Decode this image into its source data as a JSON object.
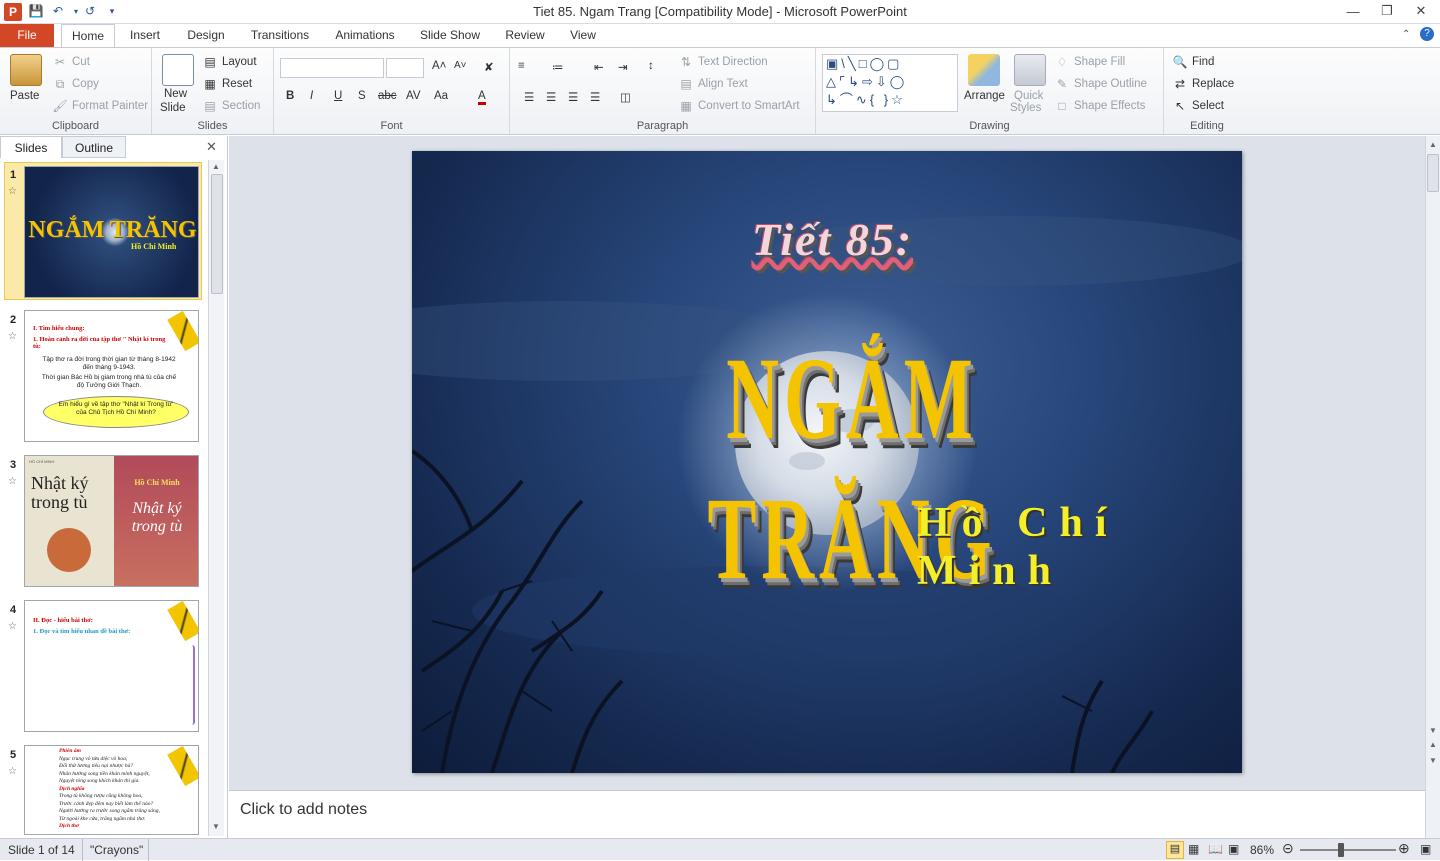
{
  "window": {
    "title": "Tiet 85. Ngam Trang [Compatibility Mode]  -  Microsoft PowerPoint"
  },
  "tabs": [
    "File",
    "Home",
    "Insert",
    "Design",
    "Transitions",
    "Animations",
    "Slide Show",
    "Review",
    "View"
  ],
  "ribbon": {
    "clipboard": {
      "label": "Clipboard",
      "paste": "Paste",
      "cut": "Cut",
      "copy": "Copy",
      "format_painter": "Format Painter"
    },
    "slides": {
      "label": "Slides",
      "new_slide_1": "New",
      "new_slide_2": "Slide",
      "layout": "Layout",
      "reset": "Reset",
      "section": "Section"
    },
    "font": {
      "label": "Font"
    },
    "paragraph": {
      "label": "Paragraph",
      "text_direction": "Text Direction",
      "align_text": "Align Text",
      "convert_smartart": "Convert to SmartArt"
    },
    "drawing": {
      "label": "Drawing",
      "arrange": "Arrange",
      "quick_styles_1": "Quick",
      "quick_styles_2": "Styles",
      "shape_fill": "Shape Fill",
      "shape_outline": "Shape Outline",
      "shape_effects": "Shape Effects"
    },
    "editing": {
      "label": "Editing",
      "find": "Find",
      "replace": "Replace",
      "select": "Select"
    }
  },
  "left_pane": {
    "tab_slides": "Slides",
    "tab_outline": "Outline",
    "thumbs": [
      {
        "num": "1"
      },
      {
        "num": "2",
        "lines": [
          "I.    Tìm hiểu chung:",
          "1. Hoàn cảnh ra đời của tập thơ \" Nhật kí trong tù:",
          "Tập thơ ra đời trong thời gian từ tháng 8-1942 đến tháng 9-1943.",
          "Thời gian Bác Hồ bị giam trong nhà tù của chế độ Tưởng Giới Thạch.",
          "Em hiểu gì về tập thơ \"Nhật kí Trong tù\" của Chủ Tịch Hồ Chí Minh?"
        ]
      },
      {
        "num": "3",
        "book_left": "Nhật ký trong tù",
        "book_right_author": "Hồ Chí Minh",
        "book_right": "Nhật ký trong tù",
        "book_left_header": "HỒ CHÍ MINH"
      },
      {
        "num": "4",
        "lines": [
          "II. Đọc - hiểu bài thơ:",
          "1.  Đọc và tìm hiểu nhan đề bài thơ:"
        ]
      },
      {
        "num": "5",
        "lines": [
          "Phiên âm",
          "Ngục trung vô tửu diệc vô hoa,",
          "Đối thử lương tiêu nại nhược hà?",
          "Nhân hướng song tiền khán minh nguyệt,",
          "Nguyệt tòng song khích khán thi gia.",
          "Dịch nghĩa",
          "Trong tù không rượu cũng không hoa,",
          "Trước cảnh đẹp đêm nay biết làm thế nào?",
          "Người hướng ra trước song ngắm trăng sáng,",
          "Từ ngoài khe cửa, trăng ngắm nhà thơ.",
          "Dịch thơ"
        ]
      }
    ]
  },
  "slide": {
    "tiet": "Tiết 85:",
    "title": "NGẮM TRĂNG",
    "author": "Hồ Chí Minh"
  },
  "notes": {
    "placeholder": "Click to add notes"
  },
  "status": {
    "slide_info": "Slide 1 of 14",
    "theme": "\"Crayons\"",
    "zoom": "86%"
  },
  "colors": {
    "file_tab": "#d24726",
    "title_yellow": "#f5c400",
    "author_yellow": "#f3ef2a"
  }
}
